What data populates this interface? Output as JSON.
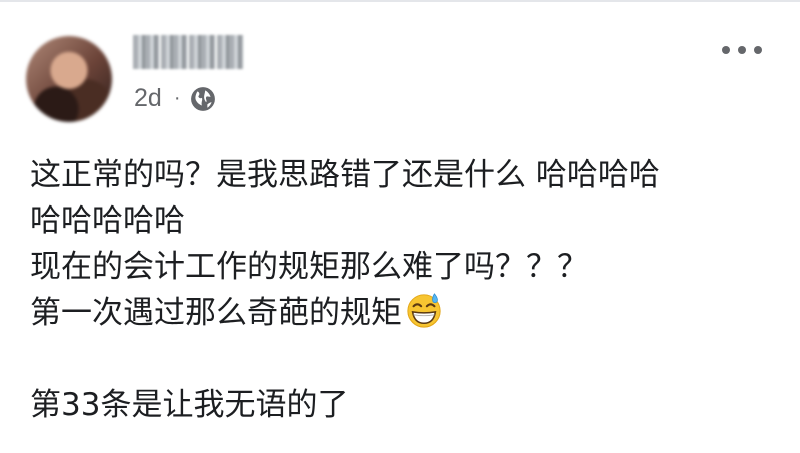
{
  "post": {
    "timestamp": "2d",
    "separator": "·",
    "audience_icon": "globe-icon",
    "menu_icon": "more-horizontal-icon",
    "lines": [
      "这正常的吗？是我思路错了还是什么 哈哈哈哈",
      "哈哈哈哈哈",
      "现在的会计工作的规矩那么难了吗？？？",
      "第一次遇过那么奇葩的规矩",
      "",
      "第33条是让我无语的了"
    ],
    "emoji": "grinning-sweat-emoji"
  },
  "colors": {
    "text": "#1c1e21",
    "meta": "#65676b",
    "background": "#ffffff"
  }
}
